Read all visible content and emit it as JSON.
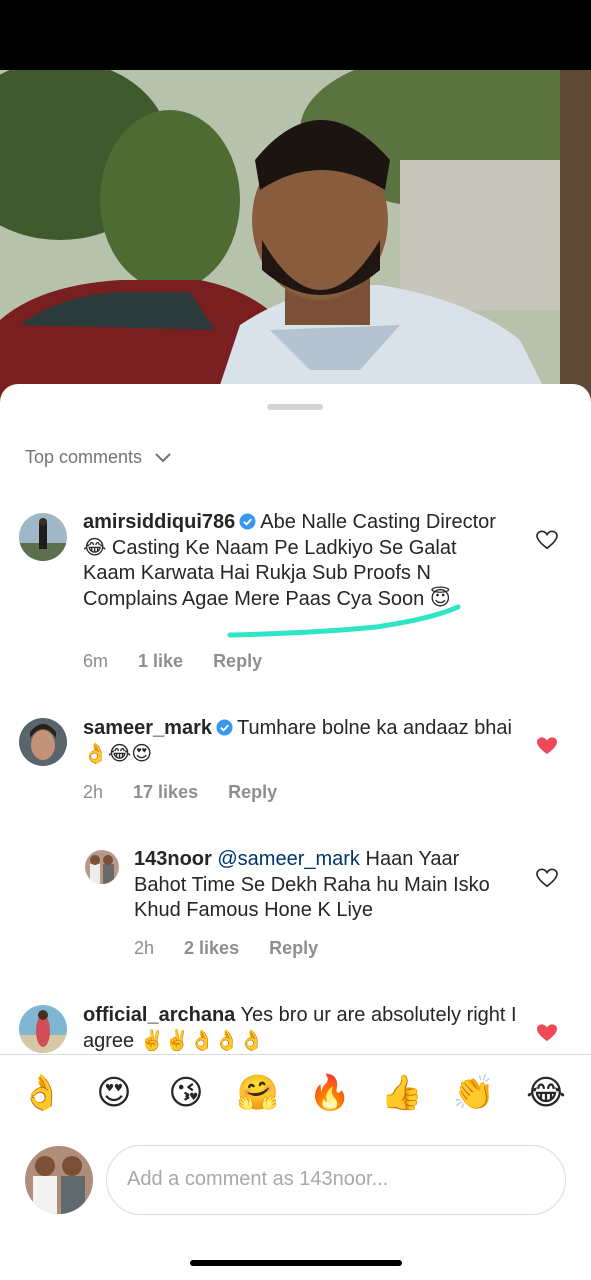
{
  "sheet": {
    "sort_label": "Top comments"
  },
  "comments": [
    {
      "username": "amirsiddiqui786",
      "verified": true,
      "text": "Abe Nalle Casting Director 😂 Casting Ke Naam Pe Ladkiyo Se Galat Kaam Karwata Hai Rukja Sub Proofs N Complains Agae Mere Paas Cya Soon 😇",
      "time": "6m",
      "likes": "1 like",
      "reply": "Reply",
      "liked": false
    },
    {
      "username": "sameer_mark",
      "verified": true,
      "text": "Tumhare bolne ka andaaz bhai 👌😂😍",
      "time": "2h",
      "likes": "17 likes",
      "reply": "Reply",
      "liked": true
    },
    {
      "username": "143noor",
      "verified": false,
      "mention": "@sameer_mark",
      "text": "Haan Yaar Bahot Time Se Dekh Raha hu Main Isko Khud Famous Hone K Liye",
      "time": "2h",
      "likes": "2 likes",
      "reply": "Reply",
      "liked": false
    },
    {
      "username": "official_archana",
      "verified": false,
      "text": "Yes bro ur are absolutely right I agree ✌️✌️👌👌👌",
      "liked": true
    }
  ],
  "emoji_reactions": [
    "👌",
    "😍",
    "😘",
    "🤗",
    "🔥",
    "👍",
    "👏",
    "😂"
  ],
  "composer": {
    "placeholder": "Add a comment as 143noor..."
  },
  "colors": {
    "liked_heart": "#ed4956",
    "highlight_stroke": "#2ee6c4",
    "verified_badge": "#3897f0"
  }
}
